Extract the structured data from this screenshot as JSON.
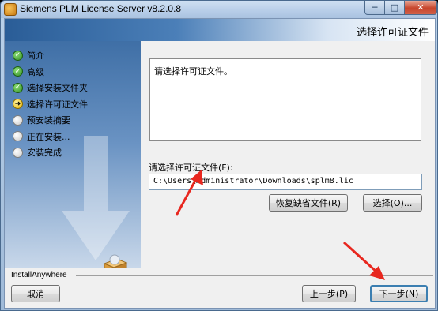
{
  "window": {
    "title": "Siemens PLM License Server v8.2.0.8",
    "min_glyph": "─",
    "max_glyph": "□",
    "close_glyph": "✕"
  },
  "header": {
    "title": "选择许可证文件"
  },
  "steps": [
    {
      "label": "简介",
      "state": "done",
      "glyph": "✓"
    },
    {
      "label": "高级",
      "state": "done",
      "glyph": "✓"
    },
    {
      "label": "选择安装文件夹",
      "state": "done",
      "glyph": "✓"
    },
    {
      "label": "选择许可证文件",
      "state": "current",
      "glyph": "➜"
    },
    {
      "label": "预安装摘要",
      "state": "pending",
      "glyph": ""
    },
    {
      "label": "正在安装...",
      "state": "pending",
      "glyph": ""
    },
    {
      "label": "安装完成",
      "state": "pending",
      "glyph": ""
    }
  ],
  "main": {
    "instructions": "请选择许可证文件。",
    "field_label": "请选择许可证文件(F):",
    "path_value": "C:\\Users\\Administrator\\Downloads\\splm8.lic",
    "restore_button": "恢复缺省文件(R)",
    "choose_button": "选择(O)..."
  },
  "footer": {
    "brand": "InstallAnywhere",
    "cancel_button": "取消",
    "prev_button": "上一步(P)",
    "next_button": "下一步(N)"
  },
  "colors": {
    "annotation_red": "#e8271f",
    "header_blue": "#2a5d97",
    "focus_blue": "#3c7fb1"
  }
}
